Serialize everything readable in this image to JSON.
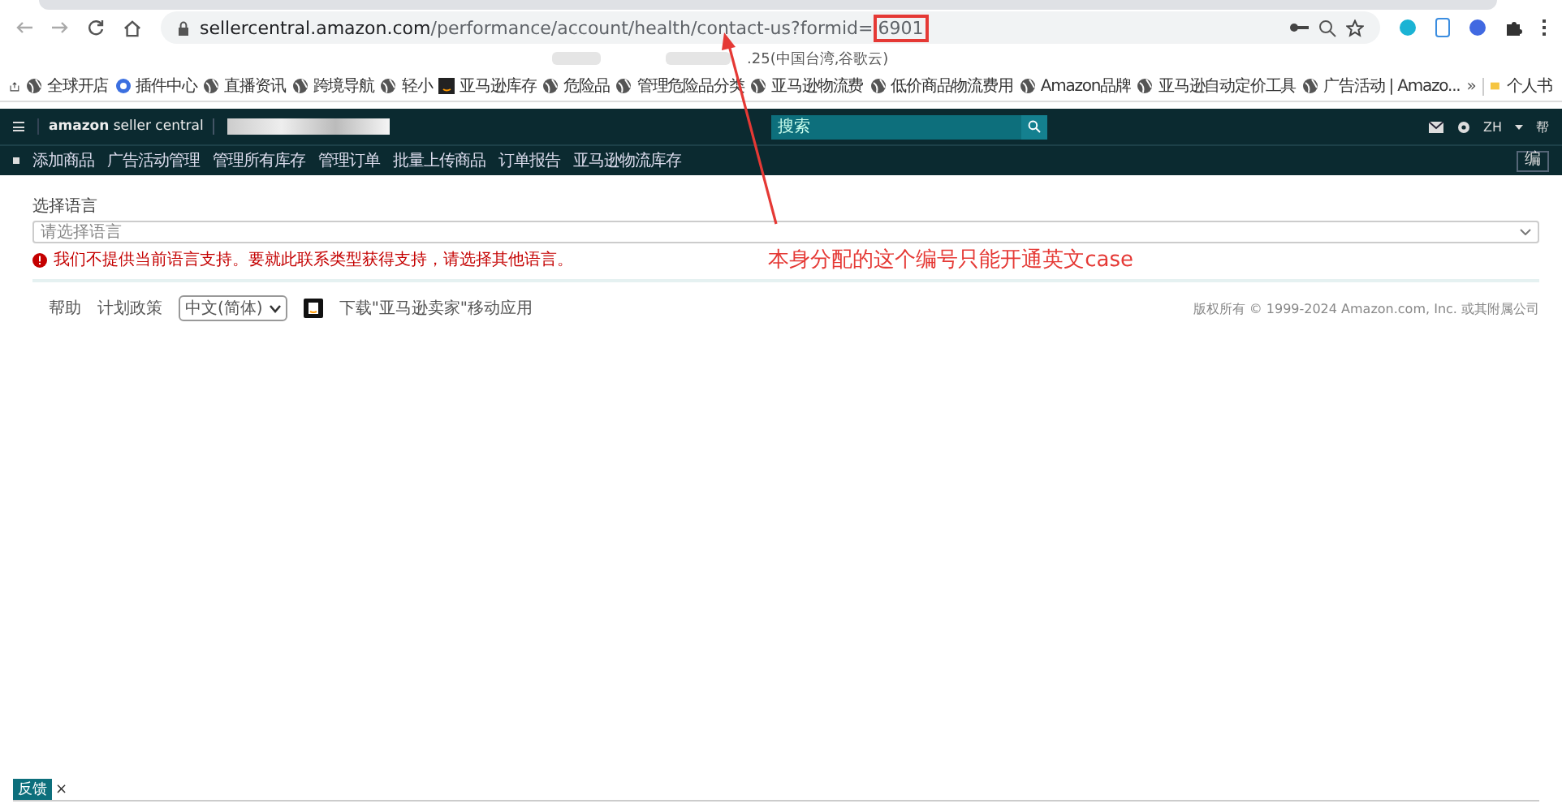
{
  "browser": {
    "url_host": "sellercentral.amazon.com",
    "url_path": "/performance/account/health/contact-us?formid=",
    "url_highlight": "6901",
    "info_text": ".25(中国台湾,谷歌云)",
    "bookmarks": [
      {
        "label": "全球开店",
        "kind": "globe"
      },
      {
        "label": "插件中心",
        "kind": "plugin"
      },
      {
        "label": "直播资讯",
        "kind": "globe"
      },
      {
        "label": "跨境导航",
        "kind": "globe"
      },
      {
        "label": "轻小",
        "kind": "globe"
      },
      {
        "label": "亚马逊库存",
        "kind": "amazon"
      },
      {
        "label": "危险品",
        "kind": "globe"
      },
      {
        "label": "管理危险品分类",
        "kind": "globe"
      },
      {
        "label": "亚马逊物流费",
        "kind": "globe"
      },
      {
        "label": "低价商品物流费用",
        "kind": "globe"
      },
      {
        "label": "Amazon品牌",
        "kind": "globe"
      },
      {
        "label": "亚马逊自动定价工具",
        "kind": "globe"
      },
      {
        "label": "广告活动 | Amazo...",
        "kind": "globe"
      }
    ],
    "more": "»",
    "folder": "个人书"
  },
  "header": {
    "logo_main": "amazon",
    "logo_sub": "seller central",
    "search_placeholder": "搜索",
    "lang": "ZH",
    "help": "帮"
  },
  "nav": {
    "items": [
      "添加商品",
      "广告活动管理",
      "管理所有库存",
      "管理订单",
      "批量上传商品",
      "订单报告",
      "亚马逊物流库存"
    ],
    "edit_button": "编"
  },
  "form": {
    "label": "选择语言",
    "placeholder": "请选择语言",
    "error": "我们不提供当前语言支持。要就此联系类型获得支持，请选择其他语言。"
  },
  "annotation": {
    "text": "本身分配的这个编号只能开通英文case"
  },
  "footer": {
    "links": [
      "帮助",
      "计划政策"
    ],
    "language": "中文(简体)",
    "app_text": "下载\"亚马逊卖家\"移动应用",
    "copyright": "版权所有 © 1999-2024 Amazon.com, Inc. 或其附属公司"
  },
  "feedback_tab": {
    "label": "反馈",
    "close": "×"
  }
}
